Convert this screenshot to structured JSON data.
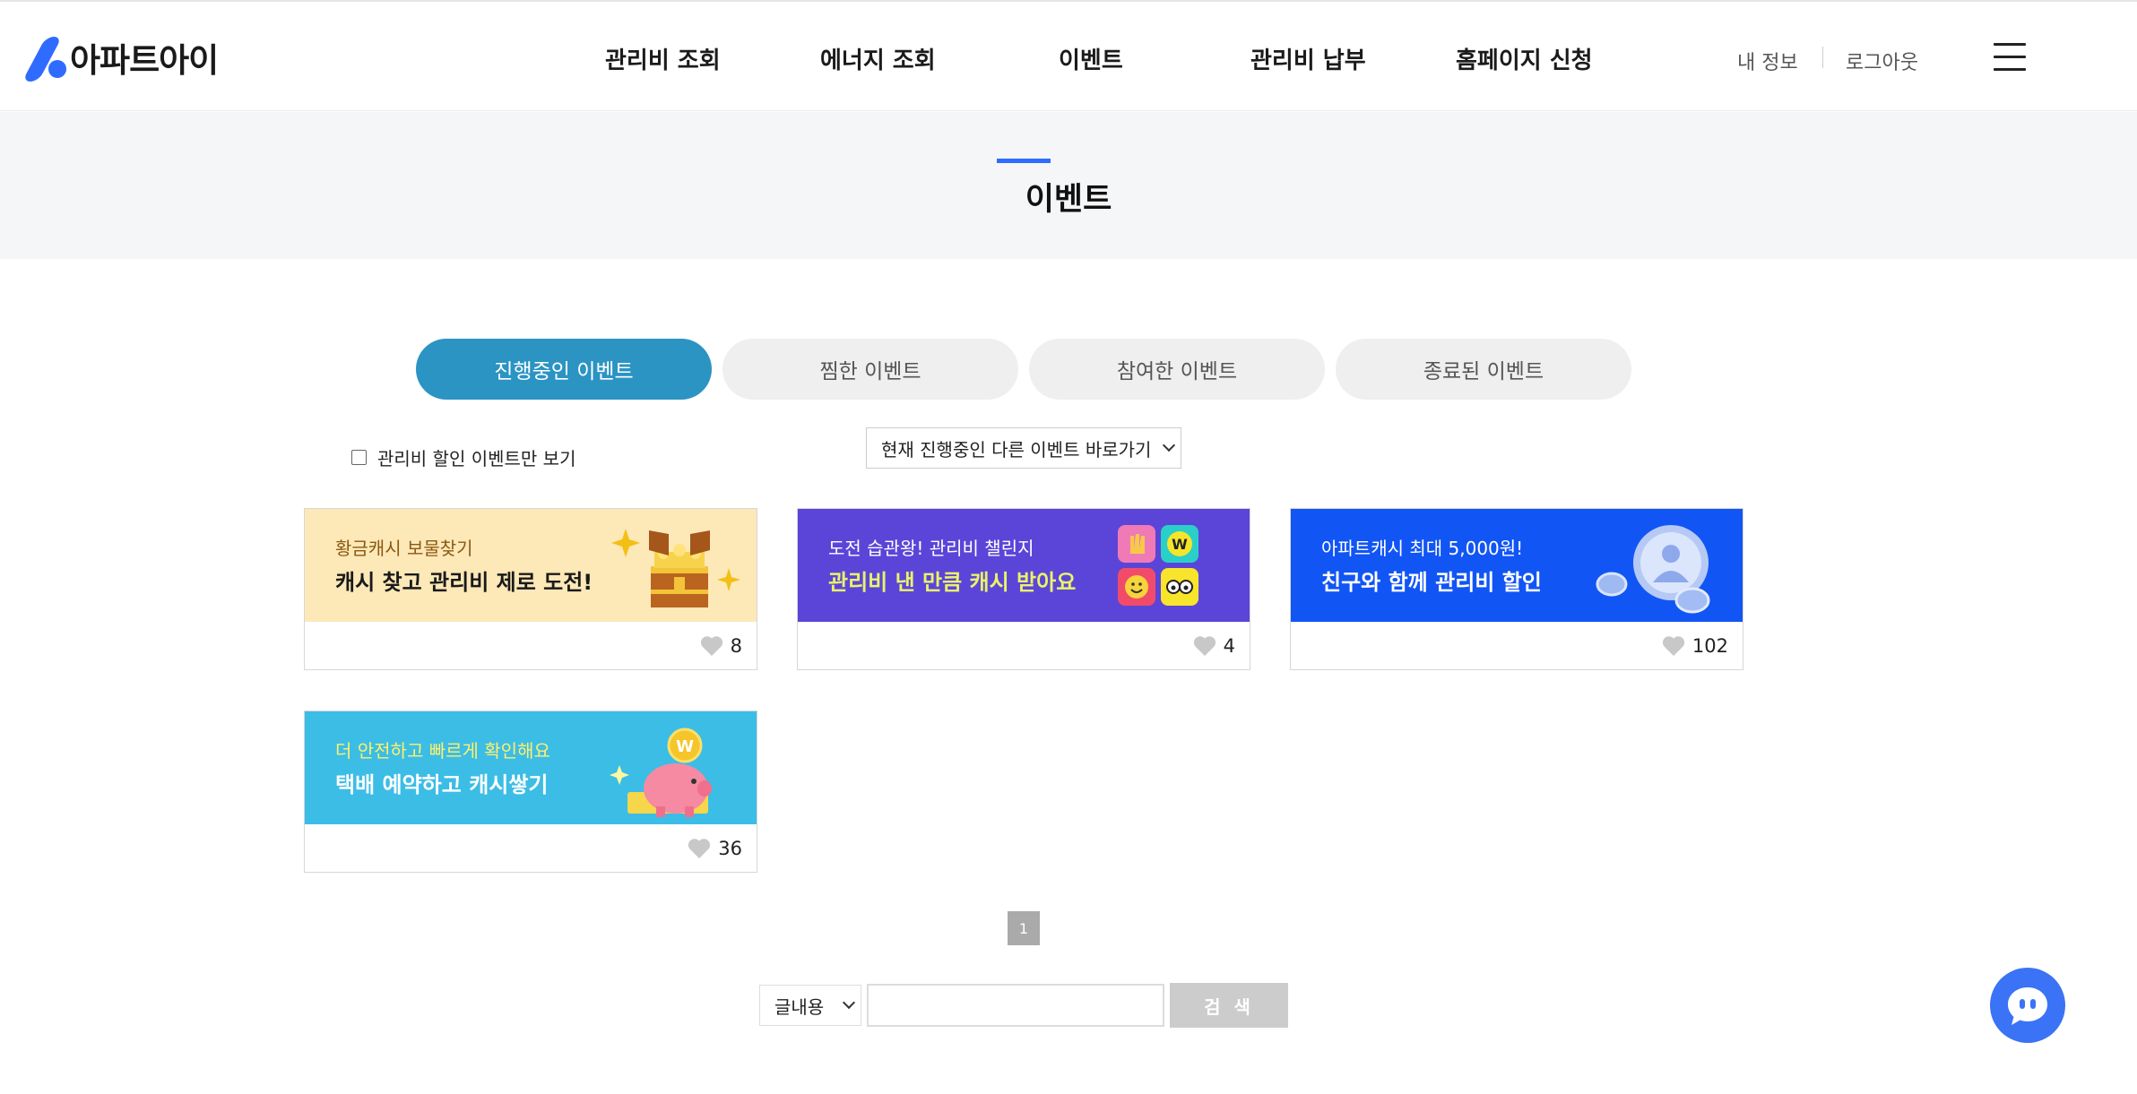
{
  "header": {
    "logo_text": "아파트아이",
    "nav": [
      "관리비 조회",
      "에너지 조회",
      "이벤트",
      "관리비 납부",
      "홈페이지 신청"
    ],
    "my_info": "내 정보",
    "logout": "로그아웃"
  },
  "page": {
    "title": "이벤트"
  },
  "tabs": [
    {
      "label": "진행중인 이벤트",
      "active": true
    },
    {
      "label": "찜한 이벤트",
      "active": false
    },
    {
      "label": "참여한 이벤트",
      "active": false
    },
    {
      "label": "종료된 이벤트",
      "active": false
    }
  ],
  "filter": {
    "checkbox_label": "관리비 할인 이벤트만 보기",
    "checked": false
  },
  "event_select": {
    "value": "현재 진행중인 다른 이벤트 바로가기"
  },
  "events": [
    {
      "subtitle": "황금캐시 보물찾기",
      "title": "캐시 찾고 관리비 제로 도전!",
      "likes": "8"
    },
    {
      "subtitle": "도전 습관왕! 관리비 챌린지",
      "title": "관리비 낸 만큼 캐시 받아요",
      "likes": "4"
    },
    {
      "subtitle": "아파트캐시 최대 5,000원!",
      "title": "친구와 함께 관리비 할인",
      "likes": "102"
    },
    {
      "subtitle": "더 안전하고 빠르게 확인해요",
      "title": "택배 예약하고 캐시쌓기",
      "likes": "36"
    }
  ],
  "pagination": {
    "current": "1"
  },
  "search": {
    "field": "글내용",
    "input_value": "",
    "button": "검 색"
  },
  "colors": {
    "brand": "#2f6bff",
    "active_tab": "#2b94c3",
    "chat": "#3a73f5"
  }
}
